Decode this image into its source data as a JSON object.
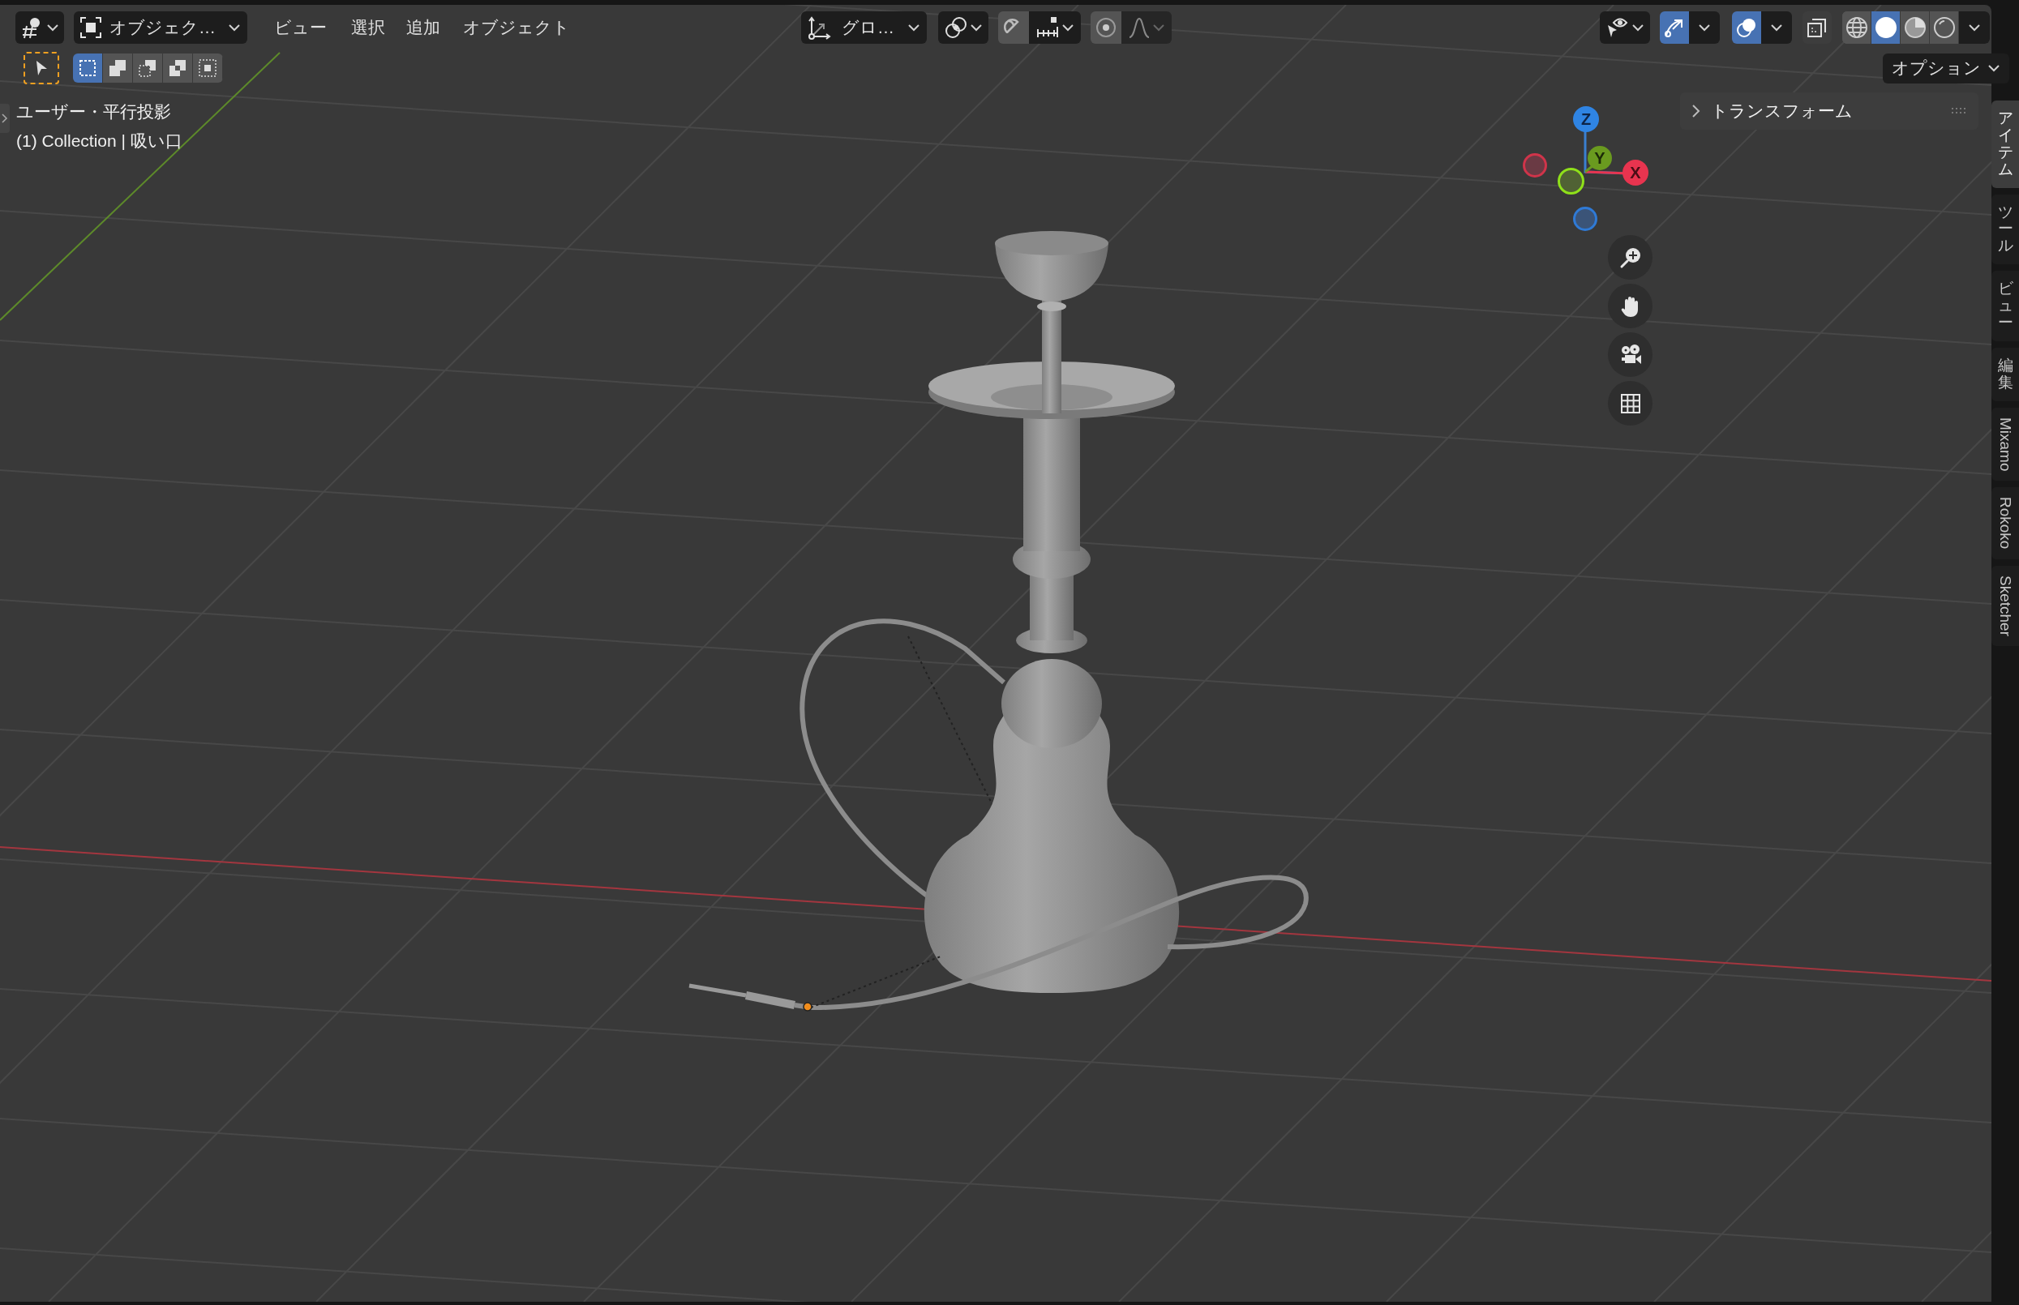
{
  "header": {
    "mode_dropdown": {
      "label": "オブジェク…"
    },
    "menus": [
      "ビュー",
      "選択",
      "追加",
      "オブジェクト"
    ],
    "transform_orientation": {
      "label": "グロ…"
    },
    "snap": {
      "on": false
    },
    "proportional_editing": {
      "on": false
    },
    "viewport_gizmos": {
      "on": true
    },
    "overlays": {
      "on": true
    },
    "xray": {
      "on": false
    },
    "shading_modes": [
      {
        "kind": "wireframe",
        "selected": false
      },
      {
        "kind": "solid",
        "selected": true
      },
      {
        "kind": "material",
        "selected": false
      },
      {
        "kind": "rendered",
        "selected": false
      }
    ]
  },
  "tool_settings": {
    "select_modes": [
      {
        "kind": "set",
        "selected": true
      },
      {
        "kind": "extend",
        "selected": false
      },
      {
        "kind": "subtract",
        "selected": false
      },
      {
        "kind": "invert",
        "selected": false
      },
      {
        "kind": "intersect",
        "selected": false
      }
    ],
    "options_dropdown": {
      "label": "オプション"
    }
  },
  "viewport": {
    "view_name": "ユーザー・平行投影",
    "collection_info": "(1) Collection | 吸い口",
    "gizmo_axes": [
      {
        "label": "Z"
      },
      {
        "label": "Y"
      },
      {
        "label": "X"
      }
    ]
  },
  "sidebar": {
    "panels": [
      {
        "title": "トランスフォーム",
        "expanded": false
      }
    ],
    "tabs": [
      {
        "label": "アイテム",
        "selected": true,
        "kind": "cjk"
      },
      {
        "label": "ツール",
        "selected": false,
        "kind": "cjk"
      },
      {
        "label": "ビュー",
        "selected": false,
        "kind": "cjk"
      },
      {
        "label": "編集",
        "selected": false,
        "kind": "cjk"
      },
      {
        "label": "Mixamo",
        "selected": false,
        "kind": "latin"
      },
      {
        "label": "Rokoko",
        "selected": false,
        "kind": "latin"
      },
      {
        "label": "Sketcher",
        "selected": false,
        "kind": "latin"
      }
    ]
  }
}
